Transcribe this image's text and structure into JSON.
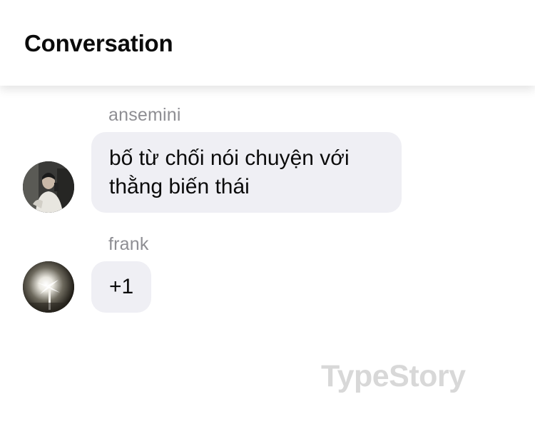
{
  "header": {
    "title": "Conversation"
  },
  "messages": [
    {
      "sender": "ansemini",
      "text_line1": "bố từ chối nói chuyện với",
      "text_line2": "thằng biến thái",
      "avatar_icon": "user-photo-avatar"
    },
    {
      "sender": "frank",
      "text": "+1",
      "avatar_icon": "user-photo-avatar"
    }
  ],
  "watermark": "TypeStory",
  "colors": {
    "bubble": "#efeff4",
    "sender_text": "#8e8e93",
    "watermark": "#d8d8d8"
  }
}
